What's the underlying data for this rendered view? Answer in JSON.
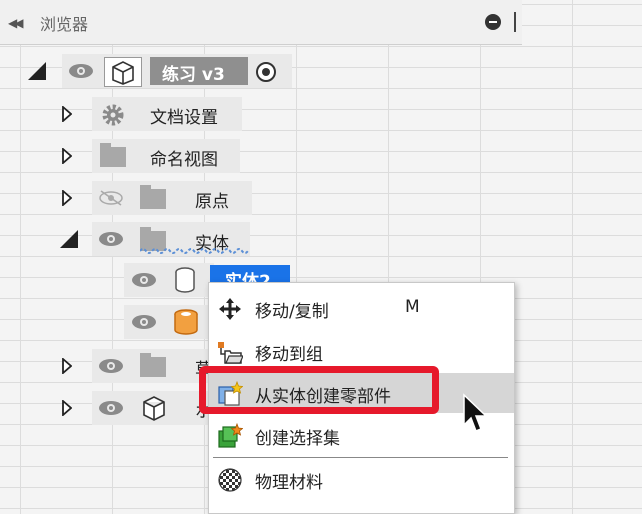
{
  "browser": {
    "title": "浏览器",
    "component": {
      "name": "练习 v3"
    },
    "nodes": {
      "doc_settings": "文档设置",
      "named_views": "命名视图",
      "origin": "原点",
      "bodies": "实体",
      "body2": "实体2",
      "sketch_partial": "草",
      "component_partial": "ホ"
    }
  },
  "context_menu": {
    "items": [
      {
        "label": "移动/复制",
        "shortcut": "M",
        "icon": "move-icon"
      },
      {
        "label": "移动到组",
        "icon": "move-to-group-icon"
      },
      {
        "label": "从实体创建零部件",
        "icon": "create-component-icon",
        "highlighted": true
      },
      {
        "label": "创建选择集",
        "icon": "selection-set-icon"
      },
      {
        "label": "物理材料",
        "icon": "physical-material-icon"
      }
    ]
  },
  "colors": {
    "selection": "#1a73e8",
    "highlight_outline": "#e6192b",
    "menu_hover": "#d6d6d6"
  }
}
